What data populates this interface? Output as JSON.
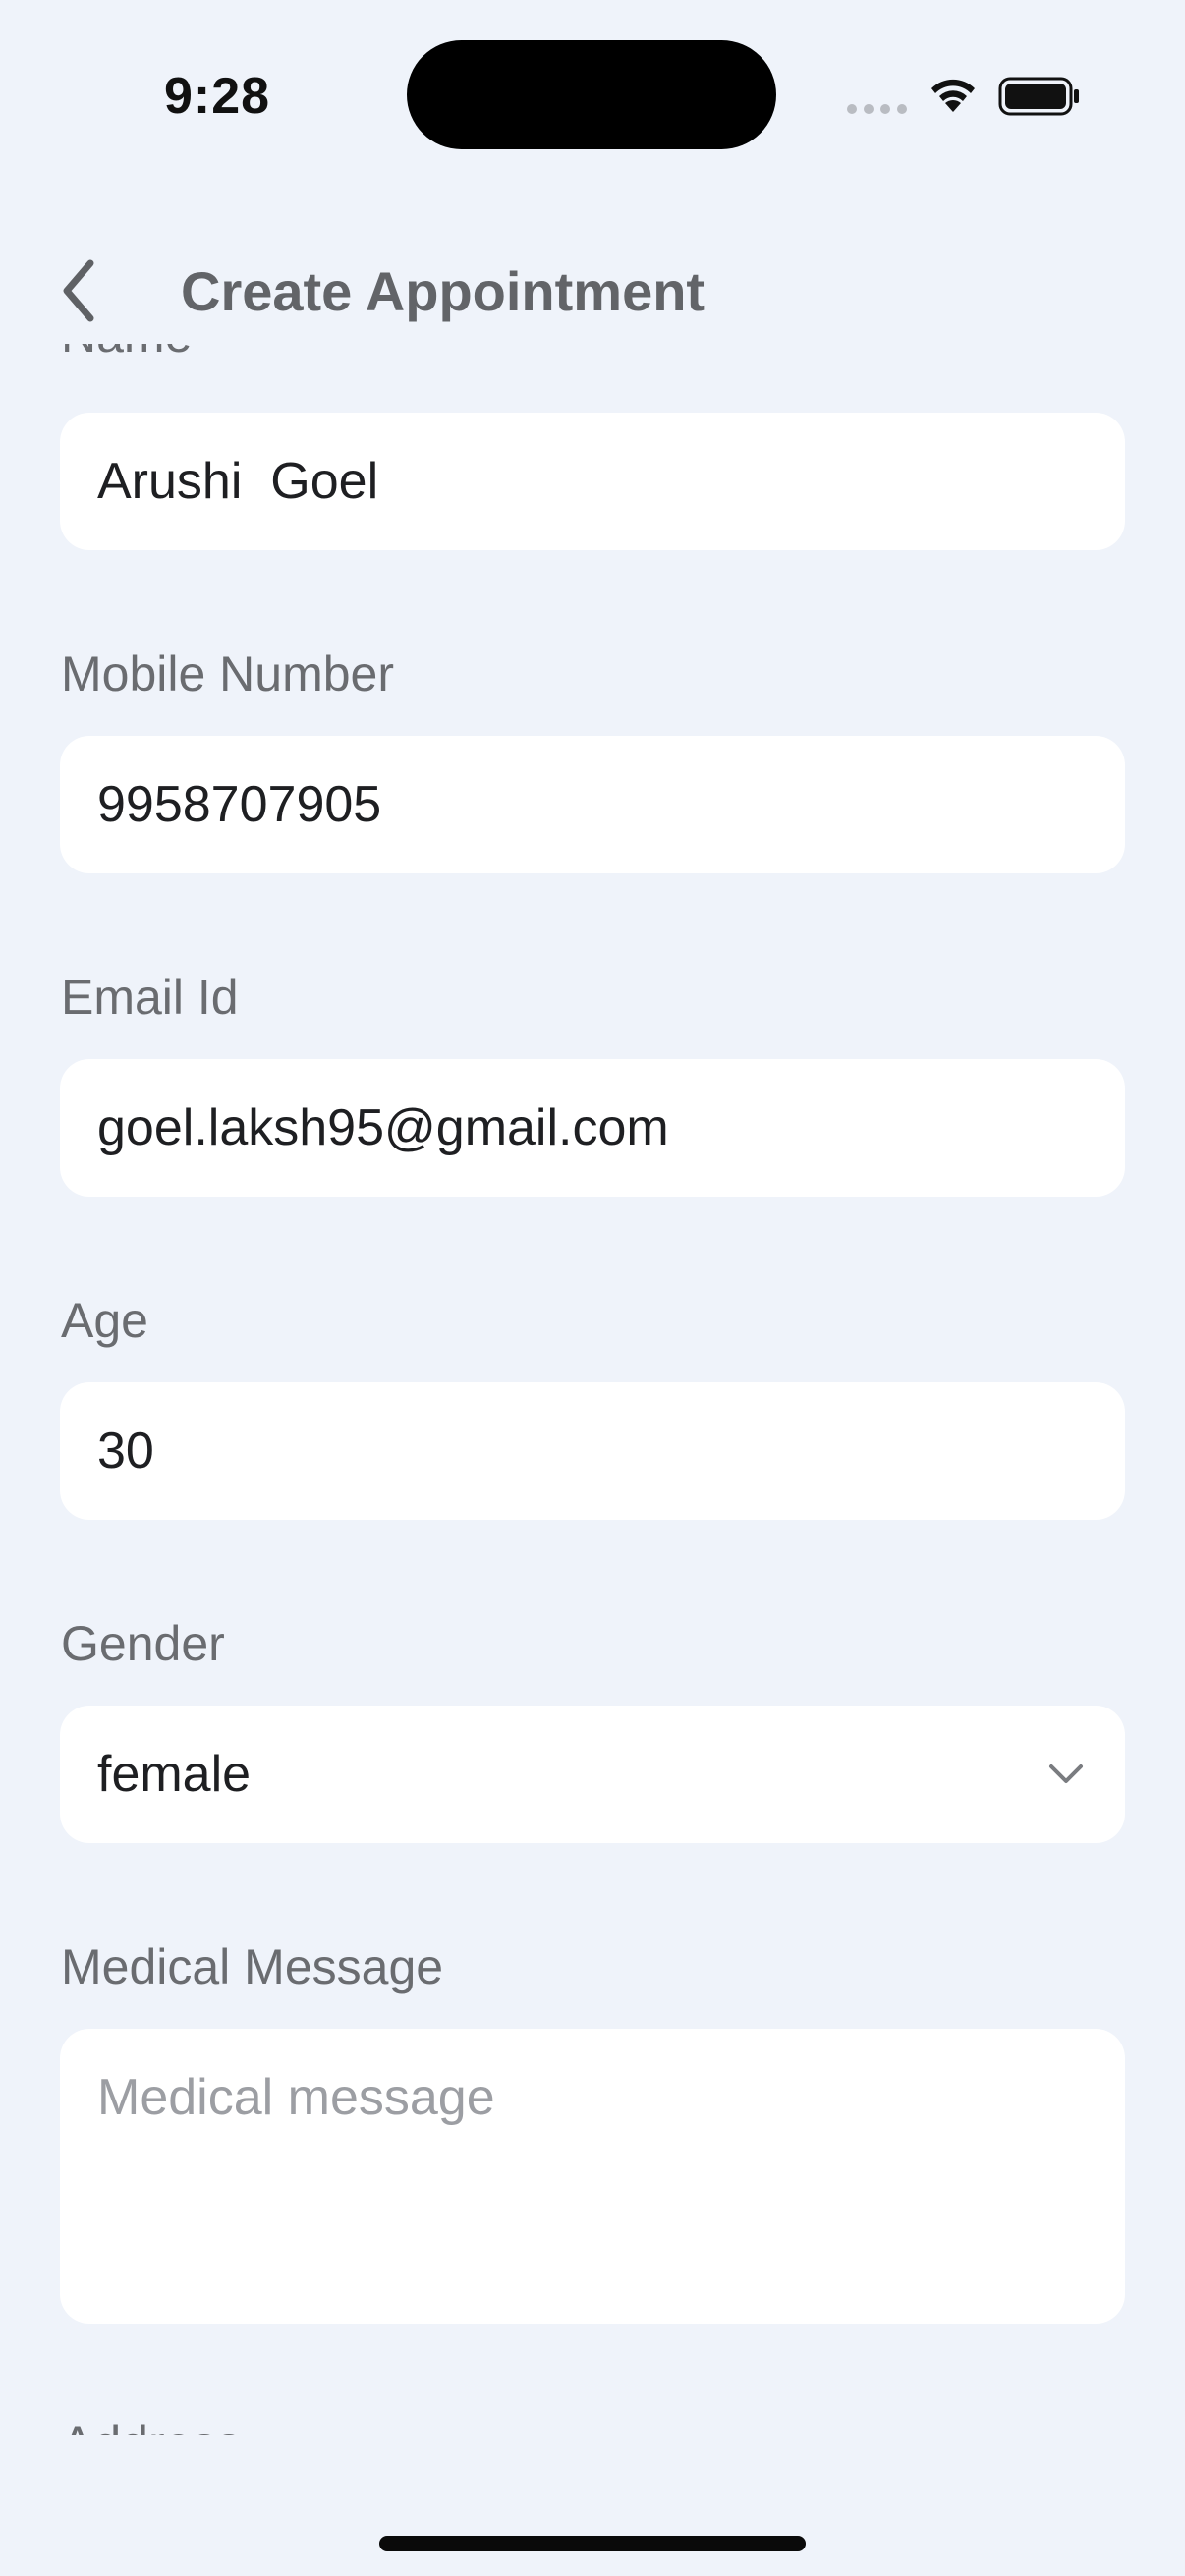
{
  "status_bar": {
    "time": "9:28"
  },
  "header": {
    "title": "Create Appointment"
  },
  "form": {
    "name": {
      "label": "Name",
      "value": "Arushi  Goel"
    },
    "mobile": {
      "label": "Mobile Number",
      "value": "9958707905"
    },
    "email": {
      "label": "Email Id",
      "value": "goel.laksh95@gmail.com"
    },
    "age": {
      "label": "Age",
      "value": "30"
    },
    "gender": {
      "label": "Gender",
      "value": "female"
    },
    "medical_message": {
      "label": "Medical Message",
      "placeholder": "Medical message"
    },
    "address": {
      "label": "Address"
    }
  },
  "icons": {
    "back": "chevron-left-icon",
    "dropdown": "chevron-down-icon",
    "wifi": "wifi-icon",
    "battery": "battery-icon",
    "signal": "signal-dots-icon"
  }
}
